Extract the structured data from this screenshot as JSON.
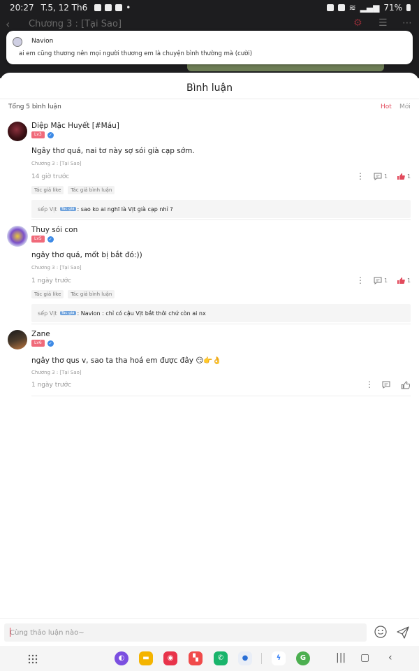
{
  "status_bar": {
    "time": "20:27",
    "date": "T.5, 12 Th6",
    "battery": "71%"
  },
  "background": {
    "chapter_title": "Chương 3 : [Tại Sao]"
  },
  "notification": {
    "sender": "Navion",
    "message": "ai em cũng thương nên mọi người thương em là chuyện bình thường mà (cười)"
  },
  "sheet": {
    "title": "Bình luận",
    "total": "Tổng 5 bình luận",
    "sort_hot": "Hot",
    "sort_new": "Mới"
  },
  "comments": [
    {
      "name": "Diệp Mặc Huyết [#Máu]",
      "level": "Lv3",
      "text": "Ngây thơ quá, nai tơ này sợ sói già cạp sớm.",
      "chapter": "Chương 3 : [Tại Sao]",
      "time": "14 giờ trước",
      "reply_count": "1",
      "like_count": "1",
      "tags": [
        "Tác giả like",
        "Tác giả bình luận"
      ],
      "reply_user": "sếp Vịt",
      "reply_badge": "Tác giả",
      "reply_text": ": sao ko ai nghĩ là Vịt già cạp nhỉ ?"
    },
    {
      "name": "Thuy sói con",
      "level": "Lv5",
      "text": "ngây thơ quá, mốt bị bắt đó:))",
      "chapter": "Chương 3 : [Tại Sao]",
      "time": "1 ngày trước",
      "reply_count": "1",
      "like_count": "1",
      "tags": [
        "Tác giả like",
        "Tác giả bình luận"
      ],
      "reply_user": "sếp Vịt",
      "reply_badge": "Tác giả",
      "reply_text": ": Navion : chỉ có cậu Vịt bắt thôi chứ còn ai nx"
    },
    {
      "name": "Zane",
      "level": "Lv6",
      "text": "ngây thơ qus v, sao ta tha hoá em được đây 😏👉👌",
      "chapter": "Chương 3 : [Tại Sao]",
      "time": "1 ngày trước"
    }
  ],
  "input": {
    "placeholder": "Cùng thảo luận nào~"
  },
  "colors": {
    "accent": "#e24a5c",
    "level_badge": "#f06a7a",
    "verified": "#3d8ae6"
  },
  "icons": [
    "emoji-icon",
    "send-icon",
    "more-icon",
    "comment-icon",
    "like-icon",
    "settings-icon",
    "list-icon"
  ]
}
